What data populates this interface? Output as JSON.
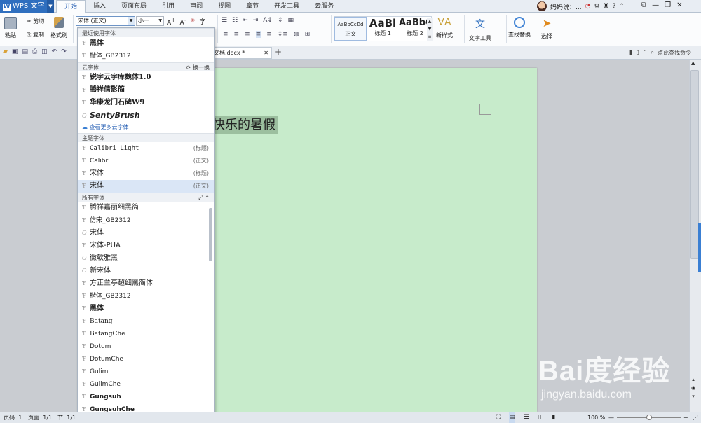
{
  "app": {
    "name": "WPS 文字"
  },
  "tabs": [
    "开始",
    "插入",
    "页面布局",
    "引用",
    "审阅",
    "视图",
    "章节",
    "开发工具",
    "云服务"
  ],
  "user": {
    "name": "妈妈说：...",
    "help": "?"
  },
  "ribbon": {
    "paste": "粘贴",
    "cut": "剪切",
    "copy": "复制",
    "format_painter": "格式刷",
    "font_name": "宋体 (正文)",
    "font_size": "小一",
    "styles": [
      {
        "preview": "AaBbCcDd",
        "label": "正文"
      },
      {
        "preview": "AaBl",
        "label": "标题 1"
      },
      {
        "preview": "AaBbC",
        "label": "标题 2"
      }
    ],
    "new_style": "新样式",
    "text_tools": "文字工具",
    "find_replace": "查找替换",
    "select": "选择"
  },
  "doc_tab": {
    "name": "文档.docx *"
  },
  "search_command": "点此查找命令",
  "document": {
    "text": "快乐的暑假"
  },
  "font_dropdown": {
    "recent_header": "最近使用字体",
    "recent": [
      "黑体",
      "楷体_GB2312"
    ],
    "cloud_header": "云字体",
    "cloud_refresh": "换一换",
    "cloud": [
      "锐字云字库魏体1.0",
      "腾祥倩影简",
      "华康龙门石碑W9",
      "SentyBrush"
    ],
    "cloud_more": "查看更多云字体",
    "theme_header": "主题字体",
    "theme": [
      {
        "name": "Calibri Light",
        "tag": "(标题)"
      },
      {
        "name": "Calibri",
        "tag": "(正文)"
      },
      {
        "name": "宋体",
        "tag": "(标题)"
      },
      {
        "name": "宋体",
        "tag": "(正文)"
      }
    ],
    "all_header": "所有字体",
    "all": [
      "腾祥嘉丽细黑简",
      "仿宋_GB2312",
      "宋体",
      "宋体-PUA",
      "微软雅黑",
      "新宋体",
      "方正兰亭超细黑简体",
      "楷体_GB2312",
      "黑体",
      "Batang",
      "BatangChe",
      "Dotum",
      "DotumChe",
      "Gulim",
      "GulimChe",
      "Gungsuh",
      "GungsuhChe"
    ]
  },
  "status": {
    "page_no": "页码: 1",
    "pages": "页面: 1/1",
    "section": "节: 1/1",
    "zoom": "100 %"
  },
  "watermark": {
    "brand": "Bai度经验",
    "url": "jingyan.baidu.com"
  }
}
